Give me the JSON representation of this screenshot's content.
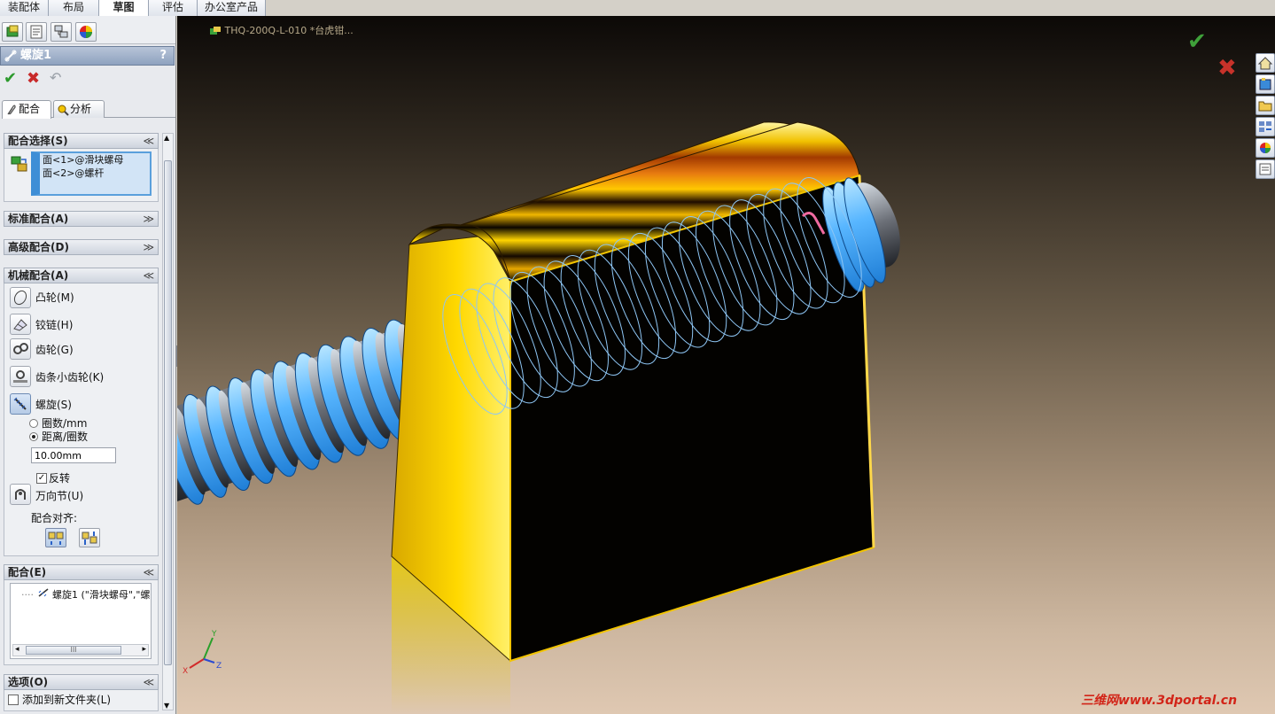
{
  "command_tabs": [
    {
      "label": "装配体",
      "active": false
    },
    {
      "label": "布局",
      "active": false
    },
    {
      "label": "草图",
      "active": true
    },
    {
      "label": "评估",
      "active": false
    },
    {
      "label": "办公室产品",
      "active": false
    }
  ],
  "property_manager": {
    "title": "螺旋1",
    "help_label": "?",
    "tabs": [
      {
        "label": "配合",
        "active": true
      },
      {
        "label": "分析",
        "active": false
      }
    ],
    "mate_selection": {
      "header": "配合选择(S)",
      "items": [
        "面<1>@滑块螺母",
        "面<2>@螺杆"
      ]
    },
    "standard_mates": {
      "header": "标准配合(A)"
    },
    "advanced_mates": {
      "header": "高级配合(D)"
    },
    "mechanical_mates": {
      "header": "机械配合(A)",
      "items": [
        {
          "label": "凸轮(M)",
          "icon": "cam-icon"
        },
        {
          "label": "铰链(H)",
          "icon": "hinge-icon"
        },
        {
          "label": "齿轮(G)",
          "icon": "gear-icon"
        },
        {
          "label": "齿条小齿轮(K)",
          "icon": "rack-pinion-icon"
        },
        {
          "label": "螺旋(S)",
          "icon": "screw-icon",
          "selected": true
        },
        {
          "label": "万向节(U)",
          "icon": "universal-joint-icon"
        }
      ],
      "radio_turns_per_mm": "圈数/mm",
      "radio_distance_per_rev": "距离/圈数",
      "selected_radio": "distance_per_rev",
      "distance_value": "10.00mm",
      "reverse_label": "反转",
      "reverse_checked": true,
      "mate_alignment_label": "配合对齐:"
    },
    "mates": {
      "header": "配合(E)",
      "entry": "螺旋1 (\"滑块螺母\",\"螺",
      "hscroll_mark": "III"
    },
    "options": {
      "header": "选项(O)",
      "add_to_folder_label": "添加到新文件夹(L)",
      "add_to_folder_checked": false
    },
    "collapse_glyph": "≫",
    "expand_glyph": "≫"
  },
  "viewport": {
    "document_title": "THQ-200Q-L-010 *台虎钳...",
    "watermark": "三维网www.3dportal.cn",
    "colors": {
      "block_yellow": "#f2c400",
      "block_black": "#020100",
      "screw_thread_blue": "#5ab7ff",
      "helix_wire": "#7fbcf0",
      "ok_green": "#3fa13a",
      "cancel_red": "#c7322a"
    }
  }
}
